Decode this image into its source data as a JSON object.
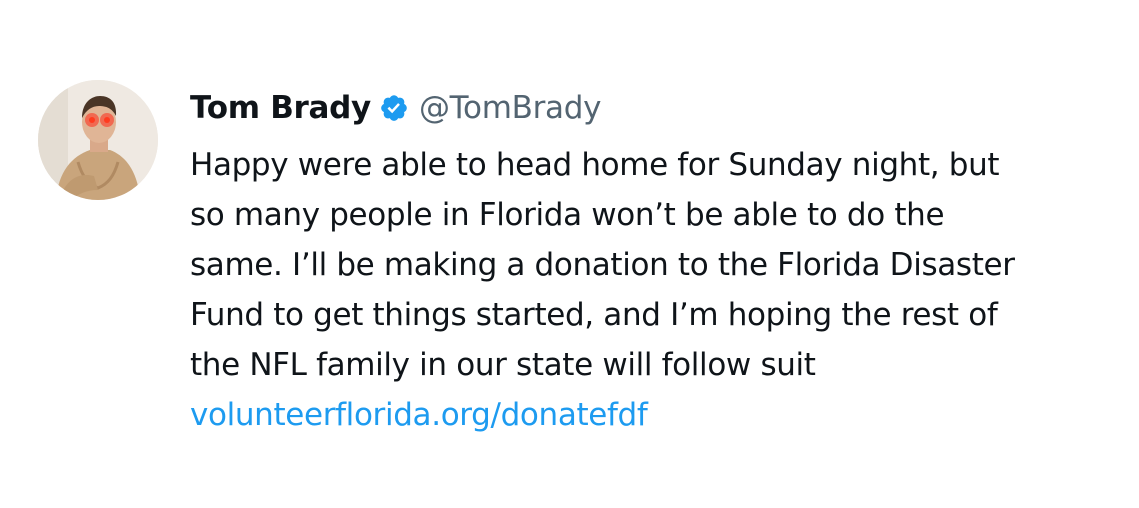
{
  "tweet": {
    "author": {
      "name": "Tom Brady",
      "handle": "@TomBrady",
      "verified": true,
      "avatar_icon": "profile-photo"
    },
    "text_lines": [
      "Happy were able to head home for Sunday night, but",
      "so many people in Florida won’t be able to do the",
      "same. I’ll be making a donation to the Florida Disaster",
      "Fund to get things started, and I’m hoping the rest of",
      "the NFL family in our state will follow suit"
    ],
    "link": "volunteerflorida.org/donatefdf"
  },
  "colors": {
    "text": "#0f1419",
    "handle": "#536471",
    "link": "#1d9bf0",
    "verified_badge": "#1d9bf0"
  }
}
